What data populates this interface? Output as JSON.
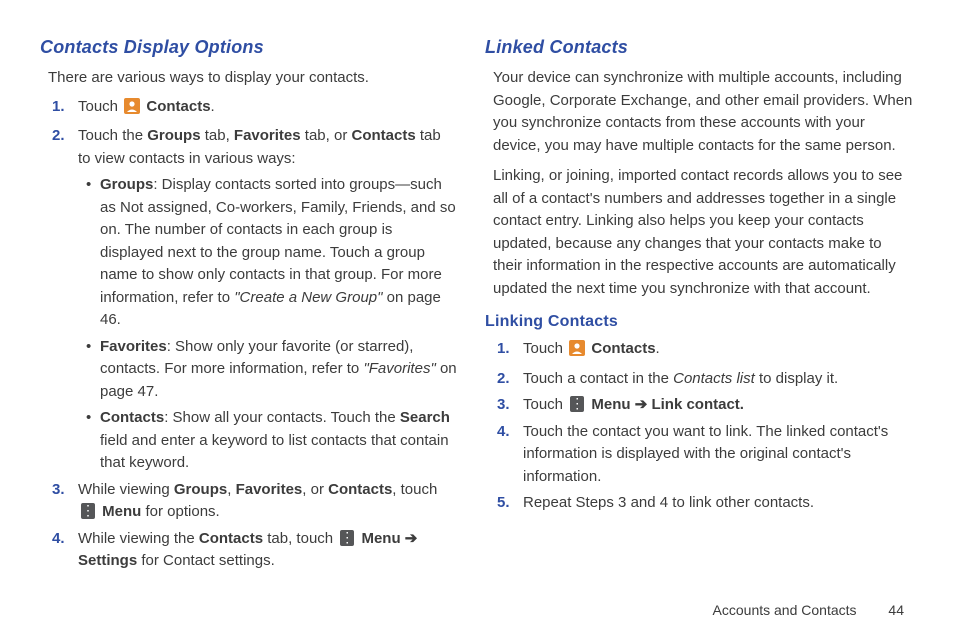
{
  "left": {
    "heading": "Contacts Display Options",
    "intro": "There are various ways to display your contacts.",
    "step1_a": "Touch ",
    "step1_b": " Contacts",
    "step1_c": ".",
    "step2_a": "Touch the ",
    "step2_groups": "Groups",
    "step2_b": " tab, ",
    "step2_favs": "Favorites",
    "step2_c": " tab, or ",
    "step2_contacts": "Contacts",
    "step2_d": " tab to view contacts in various ways:",
    "b1_head": "Groups",
    "b1_body_a": ": Display contacts sorted into groups—such as Not assigned, Co-workers, Family, Friends, and so on. The number of contacts in each group is displayed next to the group name. Touch a group name to show only contacts in that group. For more information, refer to ",
    "b1_ref": "\"Create a New Group\"",
    "b1_body_b": " on page 46.",
    "b2_head": "Favorites",
    "b2_body_a": ": Show only your favorite (or starred), contacts. For more information, refer to ",
    "b2_ref": "\"Favorites\"",
    "b2_body_b": " on page 47.",
    "b3_head": "Contacts",
    "b3_body_a": ": Show all your contacts. Touch the ",
    "b3_search": "Search",
    "b3_body_b": " field and enter a keyword to list contacts that contain that keyword.",
    "step3_a": "While viewing ",
    "step3_g": "Groups",
    "step3_b": ", ",
    "step3_f": "Favorites",
    "step3_c": ", or ",
    "step3_ct": "Contacts",
    "step3_d": ", touch ",
    "step3_menu": " Menu",
    "step3_e": " for options.",
    "step4_a": "While viewing the ",
    "step4_ct": "Contacts",
    "step4_b": " tab, touch ",
    "step4_menu": " Menu ",
    "step4_arrow": "➔",
    "step4_settings": " Settings",
    "step4_c": " for Contact settings."
  },
  "right": {
    "heading": "Linked Contacts",
    "p1": "Your device can synchronize with multiple accounts, including Google, Corporate Exchange, and other email providers. When you synchronize contacts from these accounts with your device, you may have multiple contacts for the same person.",
    "p2": "Linking, or joining, imported contact records allows you to see all of a contact's numbers and addresses together in a single contact entry. Linking also helps you keep your contacts updated, because any changes that your contacts make to their information in the respective accounts are automatically updated the next time you synchronize with that account.",
    "sub": "Linking Contacts",
    "s1_a": "Touch ",
    "s1_b": " Contacts",
    "s1_c": ".",
    "s2_a": "Touch a contact in the ",
    "s2_list": "Contacts list",
    "s2_b": " to display it.",
    "s3_a": "Touch ",
    "s3_menu": " Menu ",
    "s3_arrow": "➔",
    "s3_link": " Link contact.",
    "s4": "Touch the contact you want to link. The linked contact's information is displayed with the original contact's information.",
    "s5": "Repeat Steps 3 and 4 to link other contacts."
  },
  "footer": {
    "section": "Accounts and Contacts",
    "page": "44"
  },
  "nums": {
    "n1": "1.",
    "n2": "2.",
    "n3": "3.",
    "n4": "4.",
    "n5": "5."
  }
}
